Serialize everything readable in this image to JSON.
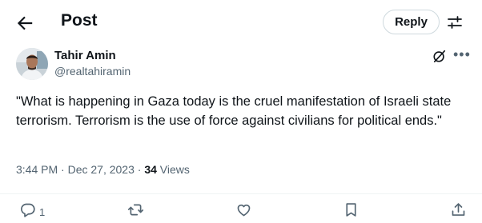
{
  "header": {
    "title": "Post",
    "reply_label": "Reply"
  },
  "icons": {
    "back": "back-arrow-icon",
    "filter": "conversation-settings-icon",
    "grok": "grok-icon",
    "more": "more-icon",
    "reply": "reply-icon",
    "repost": "repost-icon",
    "like": "like-icon",
    "bookmark": "bookmark-icon",
    "share": "share-icon"
  },
  "post": {
    "author_name": "Tahir Amin",
    "author_handle": "@realtahiramin",
    "text": "\"What is happening in Gaza today is the cruel manifestation of Israeli state terrorism. Terrorism is the use of force against civilians for political ends.\"",
    "time": "3:44 PM",
    "date": "Dec 27, 2023",
    "separator": " · ",
    "views_count": "34",
    "views_label": " Views"
  },
  "actions": {
    "reply_count": "1"
  },
  "colors": {
    "text_primary": "#0f1419",
    "text_secondary": "#536471",
    "border": "#cfd9de",
    "divider": "#eff3f4"
  }
}
